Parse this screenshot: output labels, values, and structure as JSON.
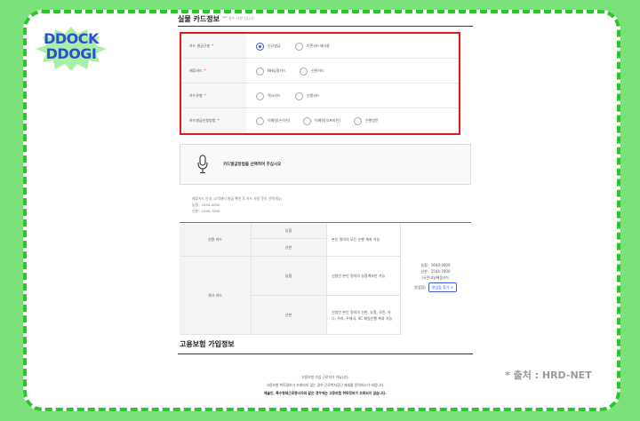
{
  "watermark": {
    "logo_line1": "DDOCK",
    "logo_line2": "DDOGI",
    "source": "* 출처 : HRD-NET"
  },
  "section": {
    "title": "실물 카드정보",
    "required_note_star": "\"*\"",
    "required_note_text": "필수 사항 입니다."
  },
  "form": {
    "rows": [
      {
        "label": "카드 발급구분",
        "options": [
          {
            "label": "신규발급",
            "selected": true
          },
          {
            "label": "기존카드재사용",
            "selected": false
          }
        ]
      },
      {
        "label": "제휴카드",
        "options": [
          {
            "label": "NH농협카드",
            "selected": false
          },
          {
            "label": "신한카드",
            "selected": false
          }
        ]
      },
      {
        "label": "카드유형",
        "options": [
          {
            "label": "체크카드",
            "selected": false
          },
          {
            "label": "신용카드",
            "selected": false
          }
        ]
      },
      {
        "label": "카드발급신청방법",
        "options": [
          {
            "label": "이메일(온라인)",
            "selected": false
          },
          {
            "label": "이메일(오프라인)",
            "selected": false
          },
          {
            "label": "은행방문",
            "selected": false
          }
        ]
      }
    ],
    "required_mark": "*"
  },
  "info": {
    "message": "카드발급방법을 선택하여 주십시오"
  },
  "notes": {
    "line1": "제휴카드 안내 (고객센터 발급 확인 후 카드 사용 문의 선택가능)",
    "line2": "농협 : 1644-4000",
    "line3": "신한 : 1544-7000"
  },
  "card_table": {
    "credit_label": "신용 카드",
    "check_label": "체크 카드",
    "credit_rows": [
      {
        "bank": "농협"
      },
      {
        "bank": "신한"
      }
    ],
    "credit_desc": "본인 명의의 모든 은행 계좌 가능",
    "check_rows": [
      {
        "bank": "농협",
        "desc": "신청인 본인 명의의 농협계좌만 가능"
      },
      {
        "bank": "신한",
        "desc": "신청인 본인 명의의 신한, 농협, 국민, 하나, 우리, 우체국, SC 제일은행 계좌 가능"
      }
    ],
    "contact_nh": "농협 : 1644-4000",
    "contact_sh": "신한 : 1544-7000",
    "contact_note": "(국민내일배움카드",
    "contact_prefix": "영업점)",
    "branch_button": "영업점 찾기 >"
  },
  "section2": {
    "title": "고용보험 가입정보"
  },
  "bottom": {
    "line1": "고용보험 가입 근로자가 아닙니다.",
    "line2": "고용보험 취득정보가 조회되지 않는 경우 근로복지공단 제세를 문의하시기 바랍니다.",
    "line3": "예술인, 특수형태근로종사자와 같은 경우에는 고용보험 취득정보가 조회되지 않습니다."
  },
  "colors": {
    "frame": "#7be27b",
    "dash": "#2bc62b",
    "highlight_border": "#e01b1b",
    "radio_selected": "#3b5bdb",
    "logo_text": "#2f4fd0",
    "logo_burst": "#a8f0a8"
  }
}
